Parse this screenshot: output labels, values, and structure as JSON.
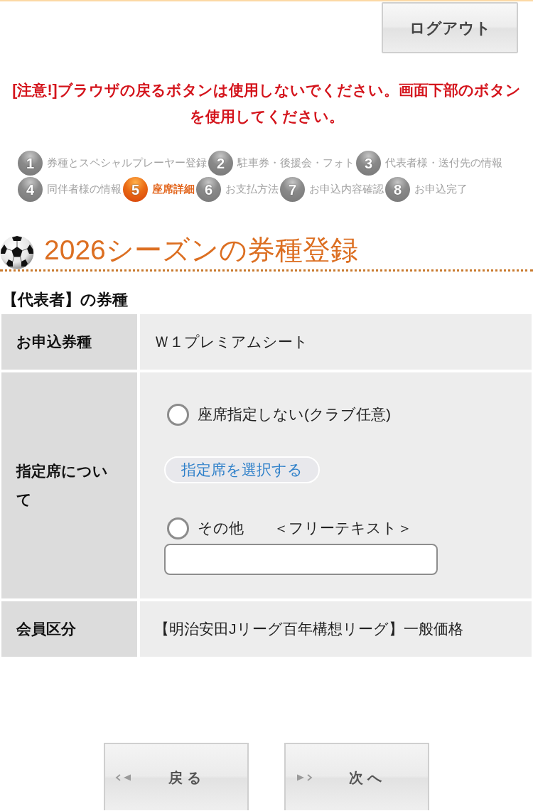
{
  "header": {
    "logout_button": "ログアウト"
  },
  "warning": "[注意!]ブラウザの戻るボタンは使用しないでください。画面下部のボタンを使用してください。",
  "steps": [
    {
      "number": "1",
      "label": "券種とスペシャルプレーヤー登録",
      "selected": false
    },
    {
      "number": "2",
      "label": "駐車券・後援会・フォト",
      "selected": false
    },
    {
      "number": "3",
      "label": "代表者様・送付先の情報",
      "selected": false
    },
    {
      "number": "4",
      "label": "同伴者様の情報",
      "selected": false
    },
    {
      "number": "5",
      "label": "座席詳細",
      "selected": true
    },
    {
      "number": "6",
      "label": "お支払方法",
      "selected": false
    },
    {
      "number": "7",
      "label": "お申込内容確認",
      "selected": false
    },
    {
      "number": "8",
      "label": "お申込完了",
      "selected": false
    }
  ],
  "section": {
    "title": "2026シーズンの券種登録",
    "subtitle": "【代表者】の券種"
  },
  "table": {
    "rows": [
      {
        "kind": "text",
        "label": "お申込券種",
        "value": "Ｗ１プレミアムシート"
      },
      {
        "kind": "controls",
        "label": "指定席について",
        "controls": [
          {
            "kind": "radio",
            "label": "座席指定しない(クラブ任意)",
            "checked": false
          },
          {
            "kind": "button",
            "label": "指定席を選択する"
          },
          {
            "kind": "radio",
            "label": "その他　　＜フリーテキスト＞",
            "checked": false
          },
          {
            "kind": "input"
          }
        ]
      },
      {
        "kind": "text",
        "label": "会員区分",
        "value": "【明治安田Jリーグ百年構想リーグ】一般価格"
      }
    ]
  },
  "nav_buttons": [
    {
      "kind": "back",
      "label": "戻 る"
    },
    {
      "kind": "next",
      "label": "次 へ"
    }
  ]
}
